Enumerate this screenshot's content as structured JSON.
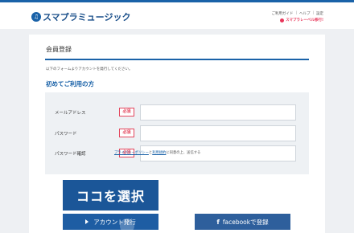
{
  "header": {
    "logo_mark": "♫",
    "logo_text": "スマプラミュージック",
    "links": [
      "ご利用ガイド",
      "ヘルプ",
      "設定"
    ],
    "promo": "スマプラレーベル移行!"
  },
  "main": {
    "title": "会員登録",
    "intro": "以下のフォームよりアカウントを発行してください。",
    "section_title": "初めてご利用の方",
    "fields": [
      {
        "label": "メールアドレス",
        "required": "必須",
        "value": "",
        "placeholder": ""
      },
      {
        "label": "パスワード",
        "required": "必須",
        "value": "",
        "placeholder": ""
      },
      {
        "label": "パスワード確認",
        "required": "必須",
        "value": "",
        "placeholder": ""
      }
    ],
    "terms": {
      "pre": "プライバシーポリシー",
      "mid": "と",
      "link": "利用規約",
      "post": "に同意の上、送信する"
    },
    "callout": "ココを選択",
    "account_button": "アカウント発行",
    "facebook_button": "facebookで登録"
  },
  "colors": {
    "brand": "#1a62a8",
    "required": "#e3465d",
    "callout": "#1b5698"
  }
}
